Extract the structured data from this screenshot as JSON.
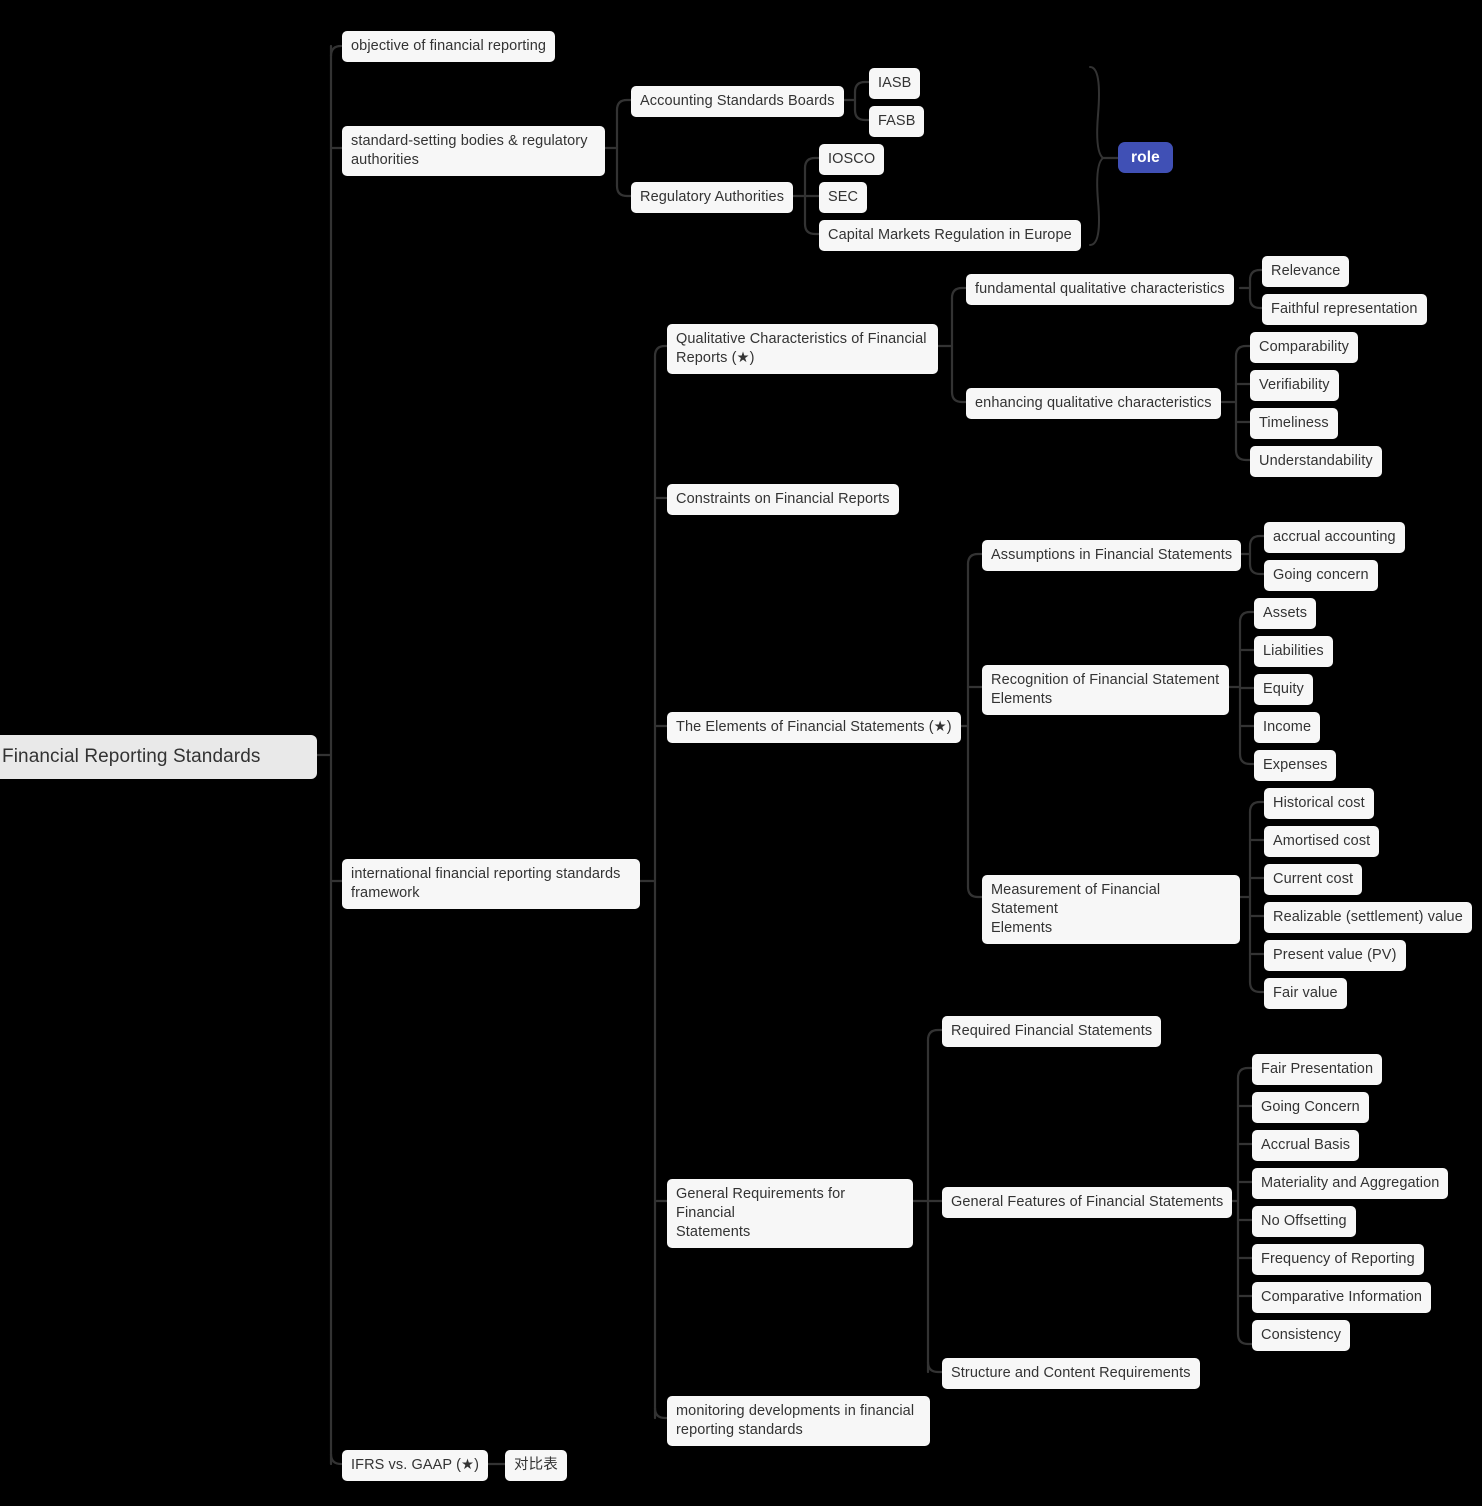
{
  "diagram": {
    "type": "mindmap",
    "title": "Financial Reporting Standards",
    "background_color": "#000000",
    "node_color": "#f7f7f7",
    "root_color": "#e9e9e9",
    "accent_color": "#4050b5",
    "text_color": "#333333",
    "edge_color": "#333333"
  },
  "nodes": {
    "root": "Financial Reporting Standards",
    "objective": "objective of financial reporting",
    "standard_setting": "standard-setting bodies & regulatory\nauthorities",
    "accounting_standards_boards": "Accounting Standards Boards",
    "iasb": "IASB",
    "fasb": "FASB",
    "regulatory_authorities": "Regulatory Authorities",
    "iosco": "IOSCO",
    "sec": "SEC",
    "capital_markets_europe": "Capital Markets Regulation in Europe",
    "role": "role",
    "ifrs_framework": "international financial reporting standards\nframework",
    "qualitative_characteristics": "Qualitative Characteristics of Financial\nReports (★)",
    "fundamental_qc": "fundamental qualitative characteristics",
    "relevance": "Relevance",
    "faithful_representation": "Faithful representation",
    "enhancing_qc": "enhancing qualitative characteristics",
    "comparability": "Comparability",
    "verifiability": "Verifiability",
    "timeliness": "Timeliness",
    "understandability": "Understandability",
    "constraints": "Constraints on Financial Reports",
    "elements": "The Elements of Financial Statements (★)",
    "assumptions": "Assumptions in Financial Statements",
    "accrual_accounting": "accrual accounting",
    "going_concern_assumption": "Going concern",
    "recognition": "Recognition of Financial Statement\nElements",
    "assets": "Assets",
    "liabilities": "Liabilities",
    "equity": "Equity",
    "income": "Income",
    "expenses": "Expenses",
    "measurement": "Measurement of Financial Statement\nElements",
    "historical_cost": "Historical cost",
    "amortised_cost": "Amortised cost",
    "current_cost": "Current cost",
    "realizable_value": "Realizable (settlement) value",
    "present_value": "Present value (PV)",
    "fair_value": "Fair value",
    "general_requirements": "General Requirements for Financial\nStatements",
    "required_statements": "Required Financial Statements",
    "general_features": "General Features of Financial Statements",
    "fair_presentation": "Fair Presentation",
    "going_concern_feature": "Going Concern",
    "accrual_basis": "Accrual Basis",
    "materiality": "Materiality and Aggregation",
    "no_offsetting": "No Offsetting",
    "frequency_reporting": "Frequency of Reporting",
    "comparative_information": "Comparative Information",
    "consistency": "Consistency",
    "structure_content": "Structure and Content Requirements",
    "monitoring": "monitoring developments in financial\nreporting standards",
    "ifrs_vs_gaap": "IFRS vs. GAAP (★)",
    "comparison_table": "对比表"
  }
}
